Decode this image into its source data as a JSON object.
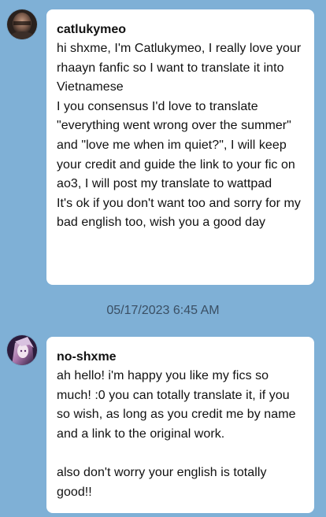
{
  "messages": [
    {
      "sender": "catlukymeo",
      "avatar_icon": "user-avatar-icon",
      "avatar_colors": [
        "#2a211d",
        "#7a5a4a",
        "#c39a82"
      ],
      "text": "hi shxme, I'm Catlukymeo, I really love your rhaayn fanfic so I want to translate it into Vietnamese\nI you consensus I'd love to translate \"everything went wrong over the summer\" and \"love me when im quiet?\", I will keep your credit and guide the link to your fic on ao3, I will post my translate to wattpad\nIt's ok if you don't want too and sorry for my bad english too, wish you a good day"
    },
    {
      "sender": "no-shxme",
      "avatar_icon": "user-avatar-icon",
      "avatar_colors": [
        "#2c1b3c",
        "#b67fb7",
        "#e8d5ea"
      ],
      "text": "ah hello! i'm happy you like my fics so much! :0 you can totally translate it, if you so wish, as long as you credit me by name and a link to the original work.\n\nalso don't worry your english is totally good!!"
    }
  ],
  "timestamp": "05/17/2023 6:45 AM",
  "colors": {
    "background": "#7fb0d6",
    "bubble": "#ffffff",
    "text": "#111111",
    "timestamp": "#3a4f64"
  }
}
